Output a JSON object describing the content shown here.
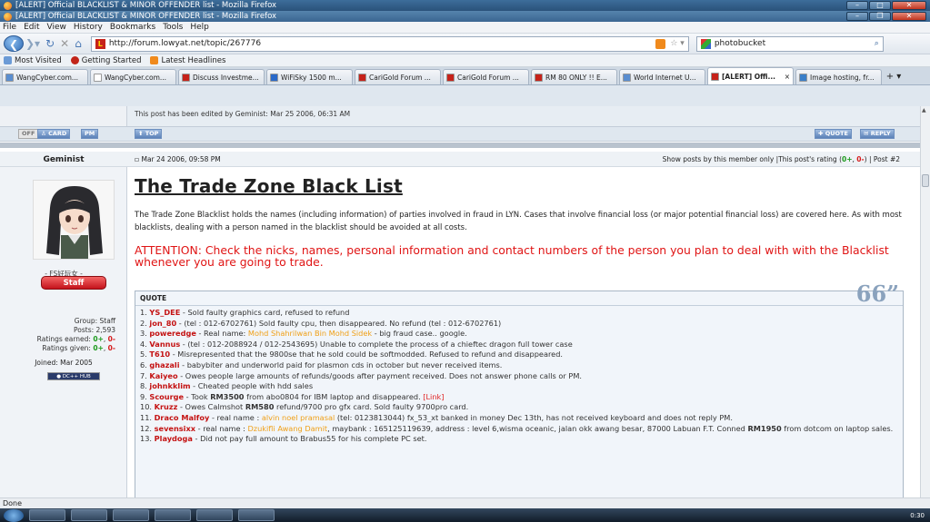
{
  "window": {
    "title1": "[ALERT] Official BLACKLIST & MINOR OFFENDER list - Mozilla Firefox",
    "title2": "[ALERT] Official BLACKLIST & MINOR OFFENDER list - Mozilla Firefox"
  },
  "menu": [
    "File",
    "Edit",
    "View",
    "History",
    "Bookmarks",
    "Tools",
    "Help"
  ],
  "nav": {
    "url": "http://forum.lowyat.net/topic/267776",
    "search_value": "photobucket"
  },
  "bookmarks": [
    "Most Visited",
    "Getting Started",
    "Latest Headlines"
  ],
  "tabs": [
    {
      "label": "WangCyber.com...",
      "color": "#5a8ed0"
    },
    {
      "label": "WangCyber.com...",
      "color": "#ffffff"
    },
    {
      "label": "Discuss Investme...",
      "color": "#c6221a"
    },
    {
      "label": "WiFiSky 1500 m...",
      "color": "#2a6ac9"
    },
    {
      "label": "CariGold Forum ...",
      "color": "#c6221a"
    },
    {
      "label": "CariGold Forum ...",
      "color": "#c6221a"
    },
    {
      "label": "RM 80 ONLY !! E...",
      "color": "#c6221a"
    },
    {
      "label": "World Internet U...",
      "color": "#5a8ed0"
    },
    {
      "label": "[ALERT] Offi...",
      "color": "#c6221a",
      "active": true
    },
    {
      "label": "Image hosting, fr...",
      "color": "#3a7fc9"
    }
  ],
  "post": {
    "edited_note": "This post has been edited by Geminist: Mar 25 2006, 06:31 AM",
    "buttons": {
      "off": "OFF",
      "card": "CARD",
      "pm": "PM",
      "top": "TOP",
      "quote": "QUOTE",
      "reply": "REPLY"
    },
    "username": "Geminist",
    "date": "Mar 24 2006, 09:58 PM",
    "meta_prefix": "Show posts by this member only |This post's rating (",
    "meta_pos": "0+",
    "meta_sep": ", ",
    "meta_neg": "0-",
    "meta_suffix": ") | Post #2",
    "rank_text": "- FS好玩女 -",
    "badge": "Staff",
    "group": "Group: Staff",
    "posts": "Posts: 2,593",
    "ratings_earned_label": "Ratings earned: ",
    "ratings_earned_pos": "0+",
    "ratings_earned_neg": "0-",
    "ratings_given_label": "Ratings given: ",
    "ratings_given_pos": "0+",
    "ratings_given_neg": "0-",
    "joined": "Joined: Mar 2005",
    "dc_badge": "DC++ HUB",
    "title": "The Trade Zone Black List",
    "intro": "The Trade Zone Blacklist holds the names (including information) of parties involved in fraud in LYN. Cases that involve financial loss (or major potential financial loss) are covered here. As with most blacklists, dealing with a person named in the blacklist should be avoided at all costs.",
    "attention": "ATTENTION: Check the nicks, names, personal information and contact numbers of the person you plan to deal with with the Blacklist whenever you are going to trade.",
    "quote_label": "QUOTE",
    "entries": [
      {
        "n": "1.",
        "nick": "YS_DEE",
        "text": " - Sold faulty graphics card, refused to refund"
      },
      {
        "n": "2.",
        "nick": "jon_80",
        "text": " - (tel : 012-6702761) Sold faulty cpu, then disappeared. No refund (tel : 012-6702761)"
      },
      {
        "n": "3.",
        "nick": "poweredge",
        "pre": " - Real name: ",
        "name": "Mohd Shahrilwan Bin Mohd Sidek",
        "text": " - big fraud case.. google."
      },
      {
        "n": "4.",
        "nick": "Vannus",
        "text": " - (tel : 012-2088924 / 012-2543695) Unable to complete the process of a chieftec dragon full tower case"
      },
      {
        "n": "5.",
        "nick": "T610",
        "text": " - Misrepresented that the 9800se that he sold could be softmodded. Refused to refund and disappeared."
      },
      {
        "n": "6.",
        "nick": "ghazali",
        "text": " - babybiter and underworld paid for plasmon cds in october but never received items."
      },
      {
        "n": "7.",
        "nick": "Kaiyeo",
        "text": " - Owes people large amounts of refunds/goods after payment received. Does not answer phone calls or PM."
      },
      {
        "n": "8.",
        "nick": "johnkklim",
        "text": " - Cheated people with hdd sales"
      },
      {
        "n": "9.",
        "nick": "Scourge",
        "pre": " - Took ",
        "bold": "RM3500",
        "text": " from abo0804 for IBM laptop and disappeared. ",
        "link": "[Link]"
      },
      {
        "n": "10.",
        "nick": "Kruzz",
        "pre": " - Owes Calmshot ",
        "bold": "RM580",
        "text": " refund/9700 pro gfx card. Sold faulty 9700pro card."
      },
      {
        "n": "11.",
        "nick": "Draco Malfoy",
        "pre": " - real name : ",
        "name": "alvin noel pramasal",
        "text": " (tel: 0123813044) fx_53_xt banked in money Dec 13th, has not received keyboard and does not reply PM."
      },
      {
        "n": "12.",
        "nick": "sevensixx",
        "pre": " - real name : ",
        "name": "Dzukifli Awang Damit",
        "text": ", maybank : 165125119639, address : level 6,wisma oceanic, jalan okk awang besar, 87000 Labuan F.T. Conned ",
        "bold": "RM1950",
        "tail": " from dotcom on laptop sales."
      },
      {
        "n": "13.",
        "nick": "Playdoga",
        "text": " - Did not pay full amount to Brabus55 for his complete PC set."
      }
    ]
  },
  "status": "Done",
  "clock": "0:30"
}
